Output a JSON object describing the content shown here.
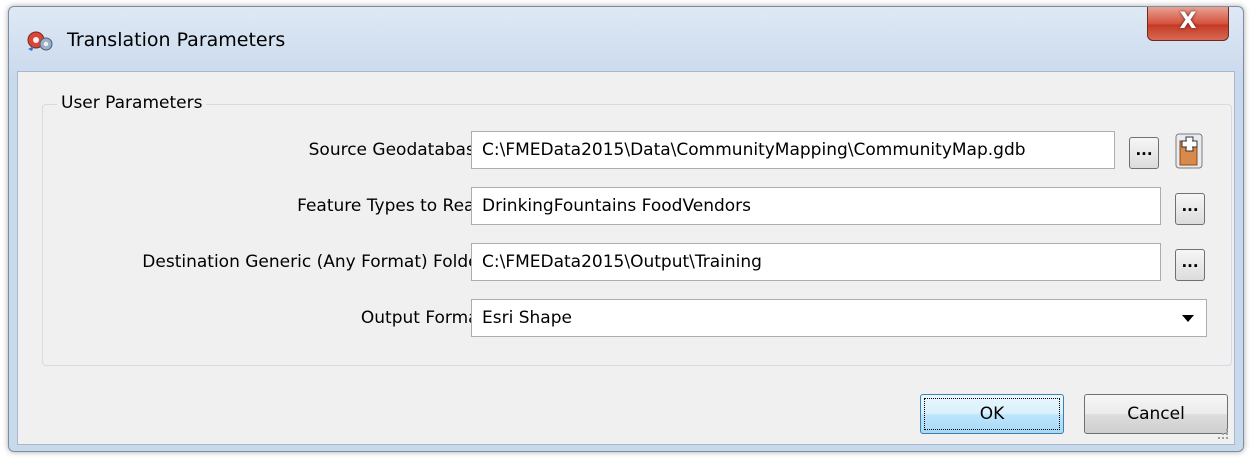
{
  "window": {
    "title": "Translation Parameters",
    "close_label": "X"
  },
  "group": {
    "title": "User Parameters"
  },
  "params": {
    "source_geodatabase": {
      "label": "Source Geodatabase:",
      "value": "C:\\FMEData2015\\Data\\CommunityMapping\\CommunityMap.gdb",
      "browse_label": "..."
    },
    "feature_types": {
      "label": "Feature Types to Read:",
      "value": "DrinkingFountains FoodVendors",
      "browse_label": "..."
    },
    "destination_folder": {
      "label": "Destination Generic (Any Format) Folder:",
      "value": "C:\\FMEData2015\\Output\\Training",
      "browse_label": "..."
    },
    "output_format": {
      "label": "Output Format:",
      "value": "Esri Shape"
    }
  },
  "buttons": {
    "ok": "OK",
    "cancel": "Cancel"
  },
  "icons": {
    "app": "fme-translation-icon",
    "add": "add-file-icon",
    "dropdown": "chevron-down-icon",
    "grip": "resize-grip-icon"
  }
}
